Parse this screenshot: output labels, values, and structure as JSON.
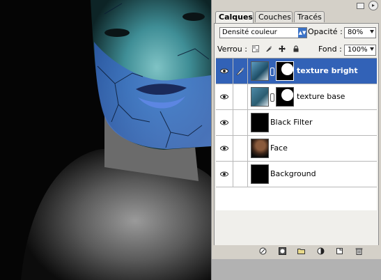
{
  "panel": {
    "tabs": [
      {
        "label": "Calques",
        "active": true
      },
      {
        "label": "Couches",
        "active": false
      },
      {
        "label": "Tracés",
        "active": false
      }
    ],
    "blend_mode": "Densité couleur",
    "opacity_label": "Opacité :",
    "opacity_value": "80%",
    "lock_label": "Verrou :",
    "fill_label": "Fond :",
    "fill_value": "100%",
    "layers": [
      {
        "name": "texture bright",
        "selected": true
      },
      {
        "name": "texture base",
        "selected": false
      },
      {
        "name": "Black Filter",
        "selected": false
      },
      {
        "name": "Face",
        "selected": false
      },
      {
        "name": "Background",
        "selected": false
      }
    ]
  },
  "colors": {
    "selection": "#3262b7",
    "panel_bg": "#d4d0c8",
    "accent": "#3a72c7"
  }
}
